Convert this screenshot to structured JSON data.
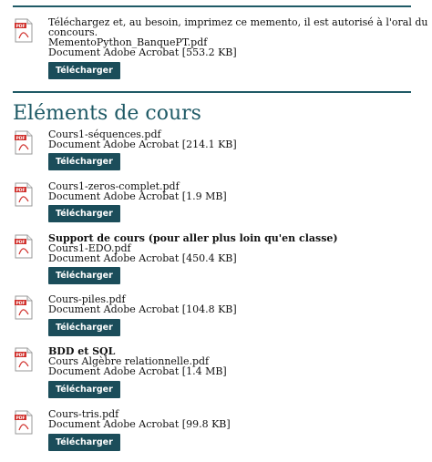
{
  "memento": {
    "lines": [
      "Téléchargez et, au besoin, imprimez ce memento, il est autorisé à l'oral du",
      "concours.",
      "MementoPython_BanquePT.pdf",
      "Document Adobe Acrobat [553.2 KB]"
    ],
    "button": "Télécharger"
  },
  "section": {
    "title": "Eléments de cours"
  },
  "items": [
    {
      "title": "",
      "file": "Cours1-séquences.pdf",
      "meta": "Document Adobe Acrobat [214.1 KB]",
      "button": "Télécharger"
    },
    {
      "title": "",
      "file": "Cours1-zeros-complet.pdf",
      "meta": "Document Adobe Acrobat [1.9 MB]",
      "button": "Télécharger"
    },
    {
      "title": "Support de cours (pour aller plus loin qu'en classe)",
      "file": "Cours1-EDO.pdf",
      "meta": "Document Adobe Acrobat [450.4 KB]",
      "button": "Télécharger"
    },
    {
      "title": "",
      "file": "Cours-piles.pdf",
      "meta": "Document Adobe Acrobat [104.8 KB]",
      "button": "Télécharger"
    },
    {
      "title": "BDD et SQL",
      "file": "Cours Algèbre relationnelle.pdf",
      "meta": "Document Adobe Acrobat [1.4 MB]",
      "button": "Télécharger"
    },
    {
      "title": "",
      "file": "Cours-tris.pdf",
      "meta": "Document Adobe Acrobat [99.8 KB]",
      "button": "Télécharger"
    }
  ],
  "icon": {
    "name": "pdf-icon",
    "label": "PDF",
    "color": "#d0312d"
  }
}
